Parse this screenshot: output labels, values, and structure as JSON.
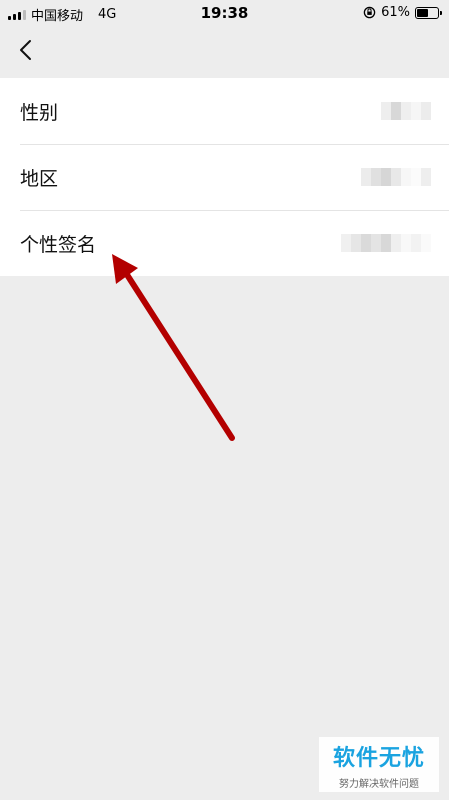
{
  "status_bar": {
    "carrier": "中国移动",
    "network": "4G",
    "time": "19:38",
    "battery": "61%",
    "battery_level": 0.61
  },
  "nav": {
    "back_icon": "chevron-left-icon"
  },
  "rows": [
    {
      "label": "性别"
    },
    {
      "label": "地区"
    },
    {
      "label": "个性签名"
    }
  ],
  "annotation": {
    "color": "#b30000"
  },
  "watermark": {
    "title": "软件无忧",
    "subtitle": "努力解决软件问题",
    "color": "#1aa3e0"
  }
}
